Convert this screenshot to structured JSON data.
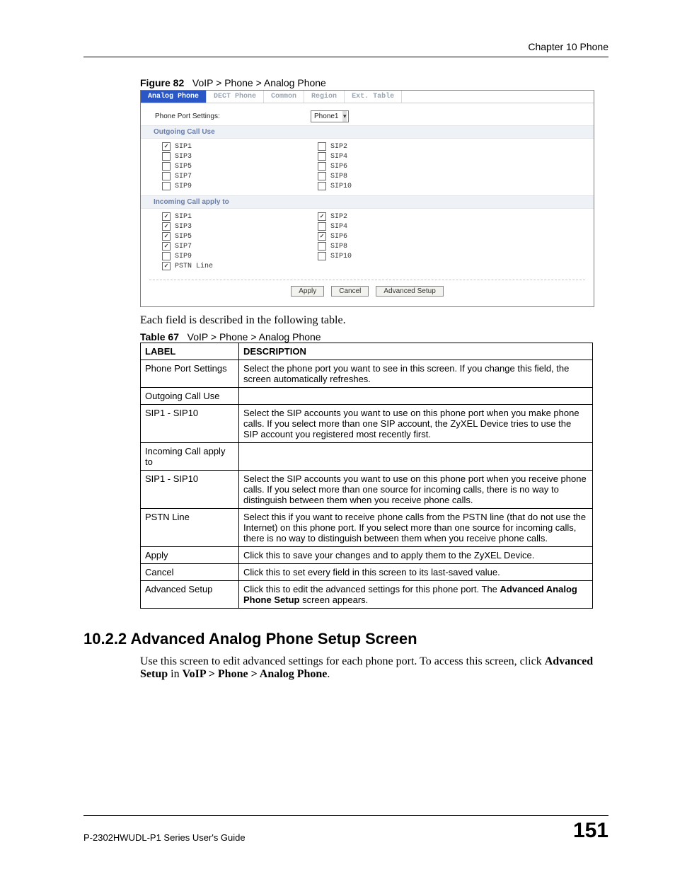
{
  "chapter_head": "Chapter 10 Phone",
  "figure_caption": {
    "label": "Figure 82",
    "text": "VoIP > Phone > Analog Phone"
  },
  "screenshot": {
    "tabs": [
      "Analog Phone",
      "DECT Phone",
      "Common",
      "Region",
      "Ext. Table"
    ],
    "port_label": "Phone Port Settings:",
    "port_select": "Phone1",
    "section_out": "Outgoing Call Use",
    "section_in": "Incoming Call apply to",
    "out_left": [
      {
        "label": "SIP1",
        "checked": true
      },
      {
        "label": "SIP3",
        "checked": false
      },
      {
        "label": "SIP5",
        "checked": false
      },
      {
        "label": "SIP7",
        "checked": false
      },
      {
        "label": "SIP9",
        "checked": false
      }
    ],
    "out_right": [
      {
        "label": "SIP2",
        "checked": false
      },
      {
        "label": "SIP4",
        "checked": false
      },
      {
        "label": "SIP6",
        "checked": false
      },
      {
        "label": "SIP8",
        "checked": false
      },
      {
        "label": "SIP10",
        "checked": false
      }
    ],
    "in_left": [
      {
        "label": "SIP1",
        "checked": true
      },
      {
        "label": "SIP3",
        "checked": true
      },
      {
        "label": "SIP5",
        "checked": true
      },
      {
        "label": "SIP7",
        "checked": true
      },
      {
        "label": "SIP9",
        "checked": false
      },
      {
        "label": "PSTN Line",
        "checked": true
      }
    ],
    "in_right": [
      {
        "label": "SIP2",
        "checked": true
      },
      {
        "label": "SIP4",
        "checked": false
      },
      {
        "label": "SIP6",
        "checked": true
      },
      {
        "label": "SIP8",
        "checked": false
      },
      {
        "label": "SIP10",
        "checked": false
      }
    ],
    "btn_apply": "Apply",
    "btn_cancel": "Cancel",
    "btn_adv": "Advanced Setup"
  },
  "para_intro": "Each field is described in the following table.",
  "table_caption": {
    "label": "Table 67",
    "text": "VoIP > Phone > Analog Phone"
  },
  "table": {
    "head_label": "LABEL",
    "head_desc": "DESCRIPTION",
    "rows": [
      {
        "label": "Phone Port Settings",
        "desc": "Select the phone port you want to see in this screen. If you change this field, the screen automatically refreshes."
      },
      {
        "label": "Outgoing Call Use",
        "desc": ""
      },
      {
        "label": "SIP1 - SIP10",
        "desc": "Select the SIP accounts you want to use on this phone port  when you make phone calls. If you select more than one SIP account, the ZyXEL Device tries to use the SIP account you registered most recently first."
      },
      {
        "label": "Incoming Call apply to",
        "desc": ""
      },
      {
        "label": "SIP1 - SIP10",
        "desc": "Select the SIP accounts you want to use on this phone port when you receive phone calls. If you select more than one source for incoming calls, there is no way to distinguish between them when you receive phone calls."
      },
      {
        "label": "PSTN Line",
        "desc": "Select this if you want to receive phone calls from the PSTN line (that do not use the Internet) on this phone port. If you select more than one source for incoming calls, there is no way to distinguish between them when you receive phone calls."
      },
      {
        "label": "Apply",
        "desc": "Click this to save your changes and to apply them to the ZyXEL Device."
      },
      {
        "label": "Cancel",
        "desc": "Click this to set every field in this screen to its last-saved value."
      }
    ],
    "row_adv_label": "Advanced Setup",
    "row_adv_pre": "Click this to edit the advanced settings for this phone port. The ",
    "row_adv_bold": "Advanced Analog Phone Setup",
    "row_adv_post": " screen appears."
  },
  "section_heading": "10.2.2  Advanced Analog Phone Setup Screen",
  "section_para_pre": "Use this screen to edit advanced settings for each phone port. To access this screen, click ",
  "section_para_b1": "Advanced Setup",
  "section_para_mid": " in ",
  "section_para_b2": "VoIP > Phone > Analog Phone",
  "section_para_end": ".",
  "footer_left": "P-2302HWUDL-P1 Series User's Guide",
  "footer_right": "151"
}
